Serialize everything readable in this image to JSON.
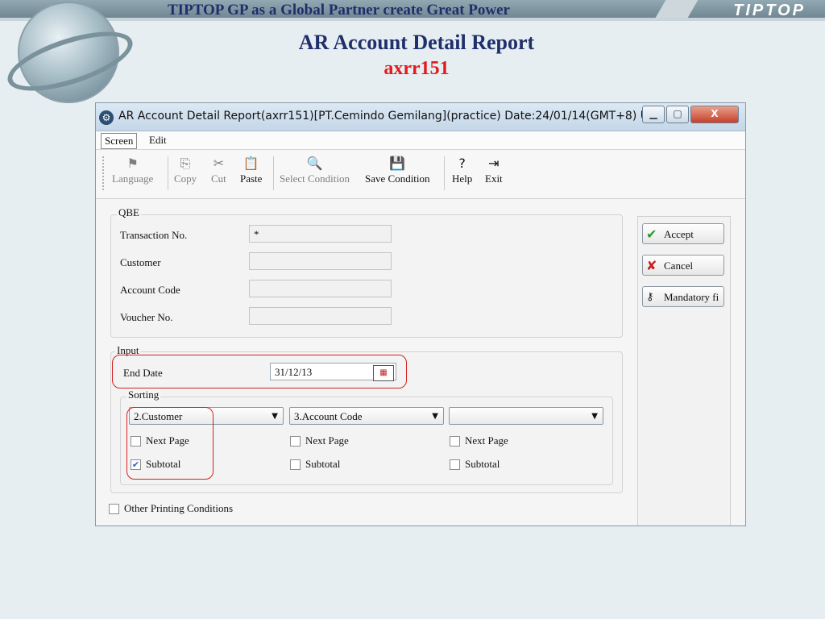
{
  "slide": {
    "banner": "TIPTOP GP as a Global Partner create Great Power",
    "brand_logo": "TIPTOP",
    "title": "AR Account Detail Report",
    "code": "axrr151"
  },
  "window": {
    "title": "AR Account Detail Report(axrr151)[PT.Cemindo Gemilang](practice)  Date:24/01/14(GMT+8)  U...",
    "controls": {
      "minimize": "▁",
      "maximize": "▢",
      "close": "X"
    }
  },
  "menu": {
    "screen": "Screen",
    "edit": "Edit"
  },
  "toolbar": {
    "language": "Language",
    "copy": "Copy",
    "cut": "Cut",
    "paste": "Paste",
    "select_condition": "Select Condition",
    "save_condition": "Save Condition",
    "help": "Help",
    "exit": "Exit"
  },
  "qbe": {
    "legend": "QBE",
    "transaction_no": {
      "label": "Transaction No.",
      "value": "*"
    },
    "customer": {
      "label": "Customer",
      "value": ""
    },
    "account_code": {
      "label": "Account Code",
      "value": ""
    },
    "voucher_no": {
      "label": "Voucher No.",
      "value": ""
    }
  },
  "input": {
    "legend": "Input",
    "end_date": {
      "label": "End Date",
      "value": "31/12/13",
      "icon": "calendar-icon"
    }
  },
  "sorting": {
    "legend": "Sorting",
    "columns": [
      {
        "selected": "2.Customer",
        "next_page_label": "Next Page",
        "next_page_checked": false,
        "subtotal_label": "Subtotal",
        "subtotal_checked": true
      },
      {
        "selected": "3.Account Code",
        "next_page_label": "Next Page",
        "next_page_checked": false,
        "subtotal_label": "Subtotal",
        "subtotal_checked": false
      },
      {
        "selected": "",
        "next_page_label": "Next Page",
        "next_page_checked": false,
        "subtotal_label": "Subtotal",
        "subtotal_checked": false
      }
    ]
  },
  "other_printing": {
    "label": "Other Printing Conditions",
    "checked": false
  },
  "actions": {
    "accept": "Accept",
    "cancel": "Cancel",
    "mandatory": "Mandatory fi"
  },
  "colors": {
    "highlight": "#d42020",
    "title_blue": "#1f2f6b",
    "code_red": "#e01b1b"
  }
}
